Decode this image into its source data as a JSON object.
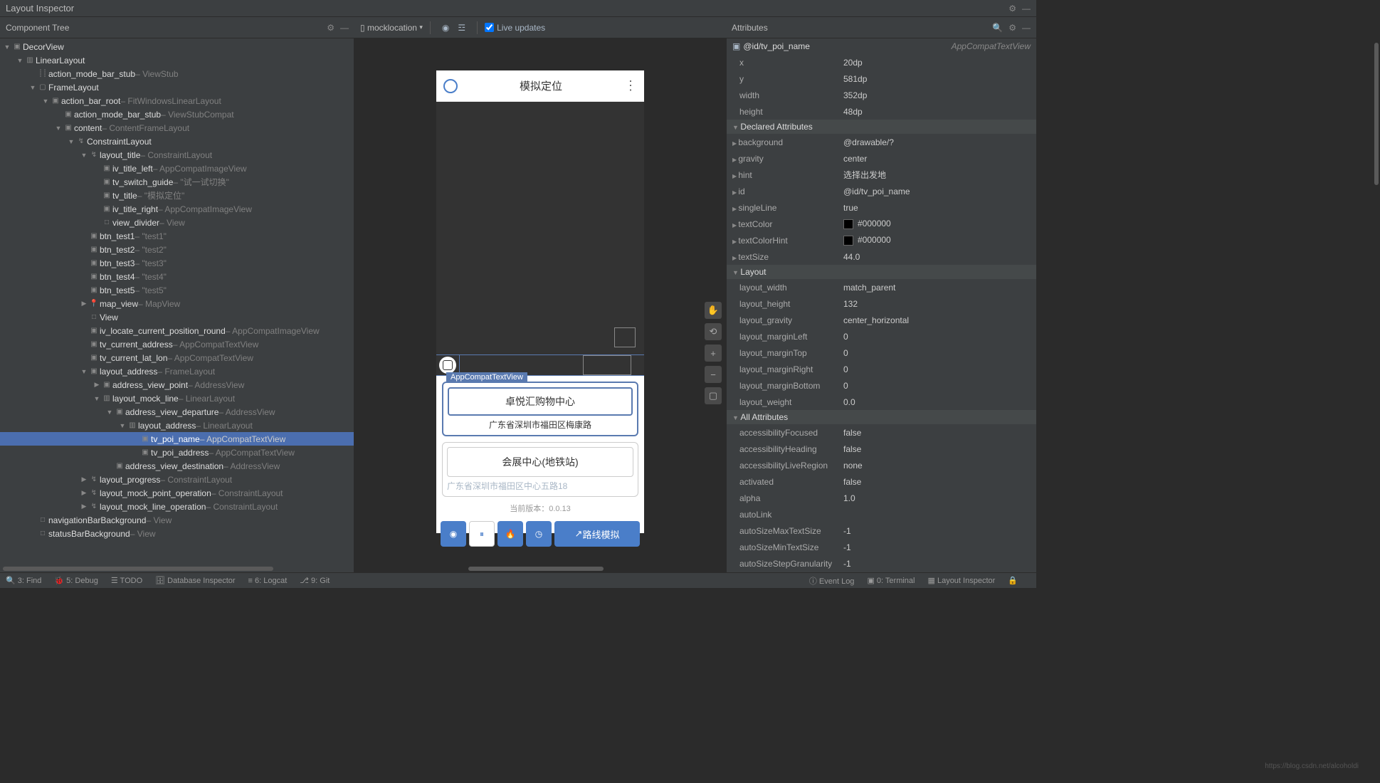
{
  "title": "Layout Inspector",
  "componentTree": {
    "label": "Component Tree"
  },
  "device": {
    "name": "mocklocation",
    "liveUpdates": "Live updates"
  },
  "attributesLabel": "Attributes",
  "selectedId": "@id/tv_poi_name",
  "selectedType": "AppCompatTextView",
  "tooltip": "AppCompatTextView",
  "tree": [
    {
      "d": 0,
      "a": "▼",
      "i": "lo",
      "n": "DecorView",
      "t": ""
    },
    {
      "d": 1,
      "a": "▼",
      "i": "ll",
      "n": "LinearLayout",
      "t": ""
    },
    {
      "d": 2,
      "a": "",
      "i": "vs",
      "n": "action_mode_bar_stub",
      "t": " – ViewStub"
    },
    {
      "d": 2,
      "a": "▼",
      "i": "fl",
      "n": "FrameLayout",
      "t": ""
    },
    {
      "d": 3,
      "a": "▼",
      "i": "lo",
      "n": "action_bar_root",
      "t": " – FitWindowsLinearLayout"
    },
    {
      "d": 4,
      "a": "",
      "i": "lo",
      "n": "action_mode_bar_stub",
      "t": " – ViewStubCompat"
    },
    {
      "d": 4,
      "a": "▼",
      "i": "lo",
      "n": "content",
      "t": " – ContentFrameLayout"
    },
    {
      "d": 5,
      "a": "▼",
      "i": "cl",
      "n": "ConstraintLayout",
      "t": ""
    },
    {
      "d": 6,
      "a": "▼",
      "i": "cl",
      "n": "layout_title",
      "t": " – ConstraintLayout"
    },
    {
      "d": 7,
      "a": "",
      "i": "lo",
      "n": "iv_title_left",
      "t": " – AppCompatImageView"
    },
    {
      "d": 7,
      "a": "",
      "i": "lo",
      "n": "tv_switch_guide",
      "t": " – \"试一试切换\""
    },
    {
      "d": 7,
      "a": "",
      "i": "lo",
      "n": "tv_title",
      "t": " – \"模拟定位\""
    },
    {
      "d": 7,
      "a": "",
      "i": "lo",
      "n": "iv_title_right",
      "t": " – AppCompatImageView"
    },
    {
      "d": 7,
      "a": "",
      "i": "sq",
      "n": "view_divider",
      "t": " – View"
    },
    {
      "d": 6,
      "a": "",
      "i": "lo",
      "n": "btn_test1",
      "t": " – \"test1\""
    },
    {
      "d": 6,
      "a": "",
      "i": "lo",
      "n": "btn_test2",
      "t": " – \"test2\""
    },
    {
      "d": 6,
      "a": "",
      "i": "lo",
      "n": "btn_test3",
      "t": " – \"test3\""
    },
    {
      "d": 6,
      "a": "",
      "i": "lo",
      "n": "btn_test4",
      "t": " – \"test4\""
    },
    {
      "d": 6,
      "a": "",
      "i": "lo",
      "n": "btn_test5",
      "t": " – \"test5\""
    },
    {
      "d": 6,
      "a": "▶",
      "i": "pin",
      "n": "map_view",
      "t": " – MapView"
    },
    {
      "d": 6,
      "a": "",
      "i": "sq",
      "n": "View",
      "t": ""
    },
    {
      "d": 6,
      "a": "",
      "i": "lo",
      "n": "iv_locate_current_position_round",
      "t": " – AppCompatImageView"
    },
    {
      "d": 6,
      "a": "",
      "i": "lo",
      "n": "tv_current_address",
      "t": " – AppCompatTextView"
    },
    {
      "d": 6,
      "a": "",
      "i": "lo",
      "n": "tv_current_lat_lon",
      "t": " – AppCompatTextView"
    },
    {
      "d": 6,
      "a": "▼",
      "i": "lo",
      "n": "layout_address",
      "t": " – FrameLayout"
    },
    {
      "d": 7,
      "a": "▶",
      "i": "lo",
      "n": "address_view_point",
      "t": " – AddressView"
    },
    {
      "d": 7,
      "a": "▼",
      "i": "ll",
      "n": "layout_mock_line",
      "t": " – LinearLayout"
    },
    {
      "d": 8,
      "a": "▼",
      "i": "lo",
      "n": "address_view_departure",
      "t": " – AddressView"
    },
    {
      "d": 9,
      "a": "▼",
      "i": "ll",
      "n": "layout_address",
      "t": " – LinearLayout"
    },
    {
      "d": 10,
      "a": "",
      "i": "lo",
      "n": "tv_poi_name",
      "t": " – AppCompatTextView",
      "sel": true
    },
    {
      "d": 10,
      "a": "",
      "i": "lo",
      "n": "tv_poi_address",
      "t": " – AppCompatTextView"
    },
    {
      "d": 8,
      "a": "",
      "i": "lo",
      "n": "address_view_destination",
      "t": " – AddressView"
    },
    {
      "d": 6,
      "a": "▶",
      "i": "cl",
      "n": "layout_progress",
      "t": " – ConstraintLayout"
    },
    {
      "d": 6,
      "a": "▶",
      "i": "cl",
      "n": "layout_mock_point_operation",
      "t": " – ConstraintLayout"
    },
    {
      "d": 6,
      "a": "▶",
      "i": "cl",
      "n": "layout_mock_line_operation",
      "t": " – ConstraintLayout"
    },
    {
      "d": 2,
      "a": "",
      "i": "sq",
      "n": "navigationBarBackground",
      "t": " – View"
    },
    {
      "d": 2,
      "a": "",
      "i": "sq",
      "n": "statusBarBackground",
      "t": " – View"
    }
  ],
  "mockApp": {
    "title": "模拟定位",
    "poi1": "卓悦汇购物中心",
    "addr1": "广东省深圳市福田区梅康路",
    "poi2": "会展中心(地铁站)",
    "addr2": "广东省深圳市福田区中心五路18",
    "version": "当前版本：0.0.13",
    "routeBtn": "路线模拟"
  },
  "dims": [
    {
      "k": "x",
      "v": "20dp"
    },
    {
      "k": "y",
      "v": "581dp"
    },
    {
      "k": "width",
      "v": "352dp"
    },
    {
      "k": "height",
      "v": "48dp"
    }
  ],
  "sections": {
    "declared": "Declared Attributes",
    "layout": "Layout",
    "all": "All Attributes"
  },
  "declared": [
    {
      "k": "background",
      "v": "@drawable/?",
      "e": 1
    },
    {
      "k": "gravity",
      "v": "center",
      "e": 1
    },
    {
      "k": "hint",
      "v": "选择出发地",
      "e": 1
    },
    {
      "k": "id",
      "v": "@id/tv_poi_name",
      "e": 1
    },
    {
      "k": "singleLine",
      "v": "true",
      "e": 1
    },
    {
      "k": "textColor",
      "v": "#000000",
      "e": 1,
      "sw": 1
    },
    {
      "k": "textColorHint",
      "v": "#000000",
      "e": 1,
      "sw": 1
    },
    {
      "k": "textSize",
      "v": "44.0",
      "e": 1
    }
  ],
  "layout": [
    {
      "k": "layout_width",
      "v": "match_parent"
    },
    {
      "k": "layout_height",
      "v": "132"
    },
    {
      "k": "layout_gravity",
      "v": "center_horizontal"
    },
    {
      "k": "layout_marginLeft",
      "v": "0"
    },
    {
      "k": "layout_marginTop",
      "v": "0"
    },
    {
      "k": "layout_marginRight",
      "v": "0"
    },
    {
      "k": "layout_marginBottom",
      "v": "0"
    },
    {
      "k": "layout_weight",
      "v": "0.0"
    }
  ],
  "all": [
    {
      "k": "accessibilityFocused",
      "v": "false"
    },
    {
      "k": "accessibilityHeading",
      "v": "false"
    },
    {
      "k": "accessibilityLiveRegion",
      "v": "none"
    },
    {
      "k": "activated",
      "v": "false"
    },
    {
      "k": "alpha",
      "v": "1.0"
    },
    {
      "k": "autoLink",
      "v": ""
    },
    {
      "k": "autoSizeMaxTextSize",
      "v": "-1"
    },
    {
      "k": "autoSizeMinTextSize",
      "v": "-1"
    },
    {
      "k": "autoSizeStepGranularity",
      "v": "-1"
    }
  ],
  "status": {
    "find": "3: Find",
    "debug": "5: Debug",
    "todo": "TODO",
    "db": "Database Inspector",
    "logcat": "6: Logcat",
    "terminal": "9: Git",
    "eventlog": "Event Log",
    "term2": "0: Terminal",
    "li": "Layout Inspector"
  },
  "watermark": "https://blog.csdn.net/alcoholdi"
}
